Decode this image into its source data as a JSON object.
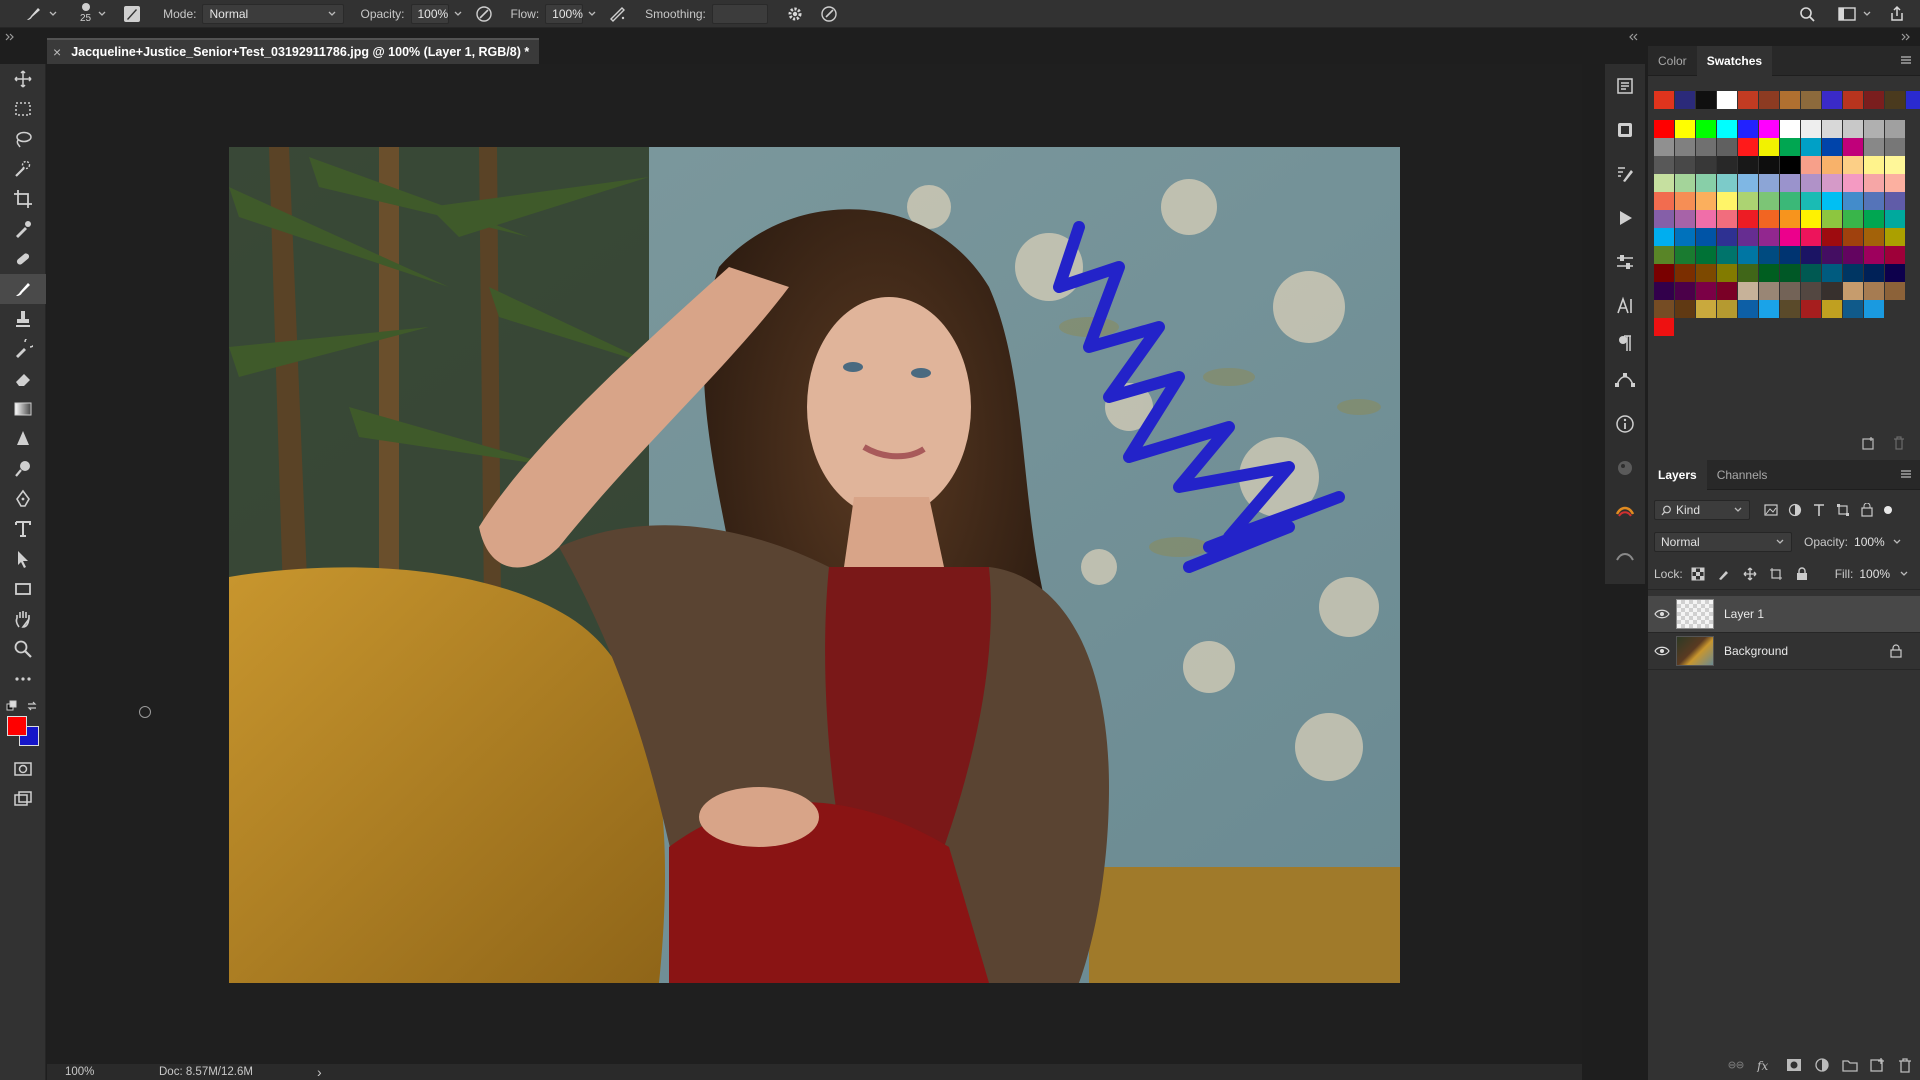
{
  "options_bar": {
    "brush_size": "25",
    "mode_label": "Mode:",
    "mode_value": "Normal",
    "opacity_label": "Opacity:",
    "opacity_value": "100%",
    "flow_label": "Flow:",
    "flow_value": "100%",
    "smoothing_label": "Smoothing:",
    "smoothing_value": ""
  },
  "document": {
    "tab_title": "Jacqueline+Justice_Senior+Test_03192911786.jpg @ 100% (Layer 1, RGB/8) *",
    "close_glyph": "×"
  },
  "status": {
    "zoom": "100%",
    "doc_size": "Doc: 8.57M/12.6M",
    "arrow": "›"
  },
  "colors": {
    "foreground": "#ff0000",
    "background": "#1515c8",
    "stroke": "#2323c9"
  },
  "swatch_panel": {
    "tabs": [
      "Color",
      "Swatches"
    ],
    "active_tab": "Swatches",
    "rows": [
      [
        "#e0341d",
        "#2b2a7a",
        "#101010",
        "#ffffff",
        "#c23b22",
        "#8c3b22",
        "#b07030",
        "#8c6a3c",
        "#3a2ac8",
        "#b8341e",
        "#7a1e1e",
        "#4a3a1e",
        "#2a2ad0",
        "#ffffff"
      ],
      [
        "#ff0000",
        "#ffff00",
        "#00ff00",
        "#00ffff",
        "#2222ff",
        "#ff00ff",
        "#ffffff",
        "#eeeeee",
        "#d8d8d8",
        "#c8c8c8",
        "#b0b0b0",
        "#a0a0a0"
      ],
      [
        "#909090",
        "#808080",
        "#707070",
        "#606060",
        "#ff1a1a",
        "#f2f200",
        "#00a651",
        "#00a0c6",
        "#0044aa",
        "#c0007a",
        "#888888",
        "#777777"
      ],
      [
        "#585858",
        "#484848",
        "#383838",
        "#282828",
        "#181818",
        "#0e0e0e",
        "#000000",
        "#f7a08a",
        "#f8b26a",
        "#fccf86",
        "#fff38c",
        "#fff799"
      ],
      [
        "#c6e0a0",
        "#a4d49a",
        "#88cfa8",
        "#7ccbc9",
        "#7fb7e4",
        "#8ca5d6",
        "#9a93cc",
        "#b092c8",
        "#d59ac8",
        "#f49ac2",
        "#f6a6a6",
        "#fcb0a0"
      ],
      [
        "#f26c4f",
        "#f68e55",
        "#fbaf5d",
        "#fff468",
        "#acd372",
        "#7cc576",
        "#3bb878",
        "#1abbb4",
        "#00bff3",
        "#438ccb",
        "#5574b9",
        "#605ca8"
      ],
      [
        "#855fa8",
        "#a763a8",
        "#f06ea9",
        "#f26d7d",
        "#ed1c24",
        "#f26522",
        "#f7941d",
        "#fff200",
        "#8dc63f",
        "#39b54a",
        "#00a651",
        "#00a99d"
      ],
      [
        "#00aeef",
        "#0072bc",
        "#0054a6",
        "#2e3192",
        "#662d91",
        "#92278f",
        "#ec008c",
        "#ed145b",
        "#9e0b0f",
        "#a0410d",
        "#a36209",
        "#aba000"
      ],
      [
        "#598527",
        "#1a7b30",
        "#007236",
        "#00746b",
        "#0076a3",
        "#004b80",
        "#003471",
        "#1b1464",
        "#440e62",
        "#630460",
        "#9e005d",
        "#9e0039"
      ],
      [
        "#790000",
        "#7b2e00",
        "#7d4900",
        "#827b00",
        "#406618",
        "#005e20",
        "#005826",
        "#005952",
        "#005b7f",
        "#003663",
        "#002157",
        "#0d004c"
      ],
      [
        "#32004b",
        "#4b0049",
        "#7b0046",
        "#7a0026",
        "#c7b299",
        "#998675",
        "#736357",
        "#534741",
        "#37302d",
        "#c69c6d",
        "#a67c52",
        "#8c6239"
      ],
      [
        "#754c24",
        "#603913",
        "#c9a93d",
        "#b59a30",
        "#0d5fa6",
        "#1aa3e8",
        "#5a4a2a",
        "#a61e1e",
        "#c0a020",
        "#105a8a",
        "#1a9ae0"
      ],
      [
        "#ee1111"
      ]
    ]
  },
  "layers_panel": {
    "tabs": [
      "Layers",
      "Channels"
    ],
    "active_tab": "Layers",
    "filter_label": "Kind",
    "blend_mode": "Normal",
    "opacity_label": "Opacity:",
    "opacity_value": "100%",
    "lock_label": "Lock:",
    "fill_label": "Fill:",
    "fill_value": "100%",
    "layers": [
      {
        "name": "Layer 1",
        "selected": true,
        "visible": true,
        "locked": false
      },
      {
        "name": "Background",
        "selected": false,
        "visible": true,
        "locked": true
      }
    ]
  },
  "tools": [
    "move-tool",
    "marquee-tool",
    "lasso-tool",
    "quick-selection-tool",
    "crop-tool",
    "eyedropper-tool",
    "healing-brush-tool",
    "brush-tool",
    "clone-stamp-tool",
    "history-brush-tool",
    "eraser-tool",
    "gradient-tool",
    "blur-tool",
    "dodge-tool",
    "pen-tool",
    "type-tool",
    "path-selection-tool",
    "rectangle-tool",
    "hand-tool",
    "zoom-tool",
    "more-tools"
  ]
}
